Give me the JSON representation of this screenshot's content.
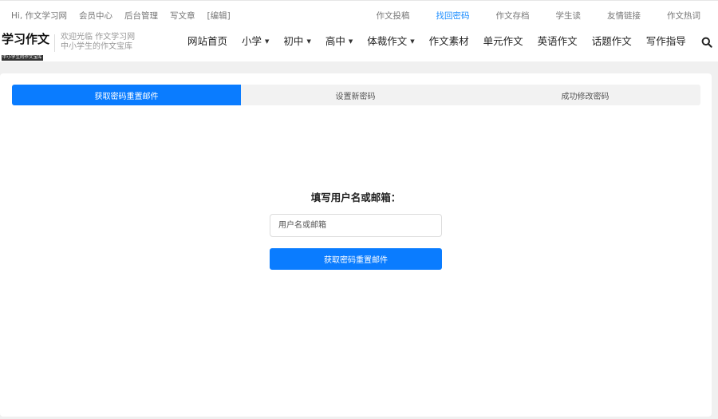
{
  "topbar": {
    "left": [
      "Hi, 作文学习网",
      "会员中心",
      "后台管理",
      "写文章",
      "[编辑]"
    ],
    "right": [
      "作文投稿",
      "找回密码",
      "作文存档",
      "学生读",
      "友情链接",
      "作文热词"
    ],
    "active_right": "找回密码"
  },
  "logo": {
    "main": "学习作文",
    "sub": "中小学生的作文宝库"
  },
  "slogan": {
    "line1": "欢迎光临 作文学习网",
    "line2": "中小学生的作文宝库"
  },
  "nav": [
    {
      "label": "网站首页",
      "dropdown": false
    },
    {
      "label": "小学",
      "dropdown": true
    },
    {
      "label": "初中",
      "dropdown": true
    },
    {
      "label": "高中",
      "dropdown": true
    },
    {
      "label": "体裁作文",
      "dropdown": true
    },
    {
      "label": "作文素材",
      "dropdown": false
    },
    {
      "label": "单元作文",
      "dropdown": false
    },
    {
      "label": "英语作文",
      "dropdown": false
    },
    {
      "label": "话题作文",
      "dropdown": false
    },
    {
      "label": "写作指导",
      "dropdown": false
    }
  ],
  "steps": [
    "获取密码重置邮件",
    "设置新密码",
    "成功修改密码"
  ],
  "form": {
    "title": "填写用户名或邮箱：",
    "input_placeholder": "用户名或邮箱",
    "input_value": "",
    "submit_label": "获取密码重置邮件"
  },
  "colors": {
    "accent": "#0a7cff",
    "active_link": "#1a8cff"
  },
  "icons": {
    "search": "search-icon",
    "caret": "caret-down-icon"
  }
}
